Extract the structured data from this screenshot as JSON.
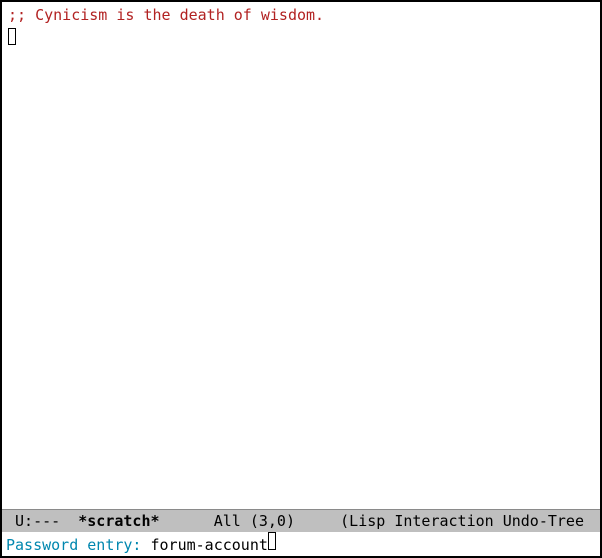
{
  "buffer": {
    "comment": ";; Cynicism is the death of wisdom."
  },
  "modeline": {
    "left": " U:---  ",
    "buffer_name": "*scratch*",
    "middle": "      All (3,0)     ",
    "modes": "(Lisp Interaction Undo-Tree"
  },
  "minibuffer": {
    "prompt": "Password entry: ",
    "value": "forum-account"
  }
}
